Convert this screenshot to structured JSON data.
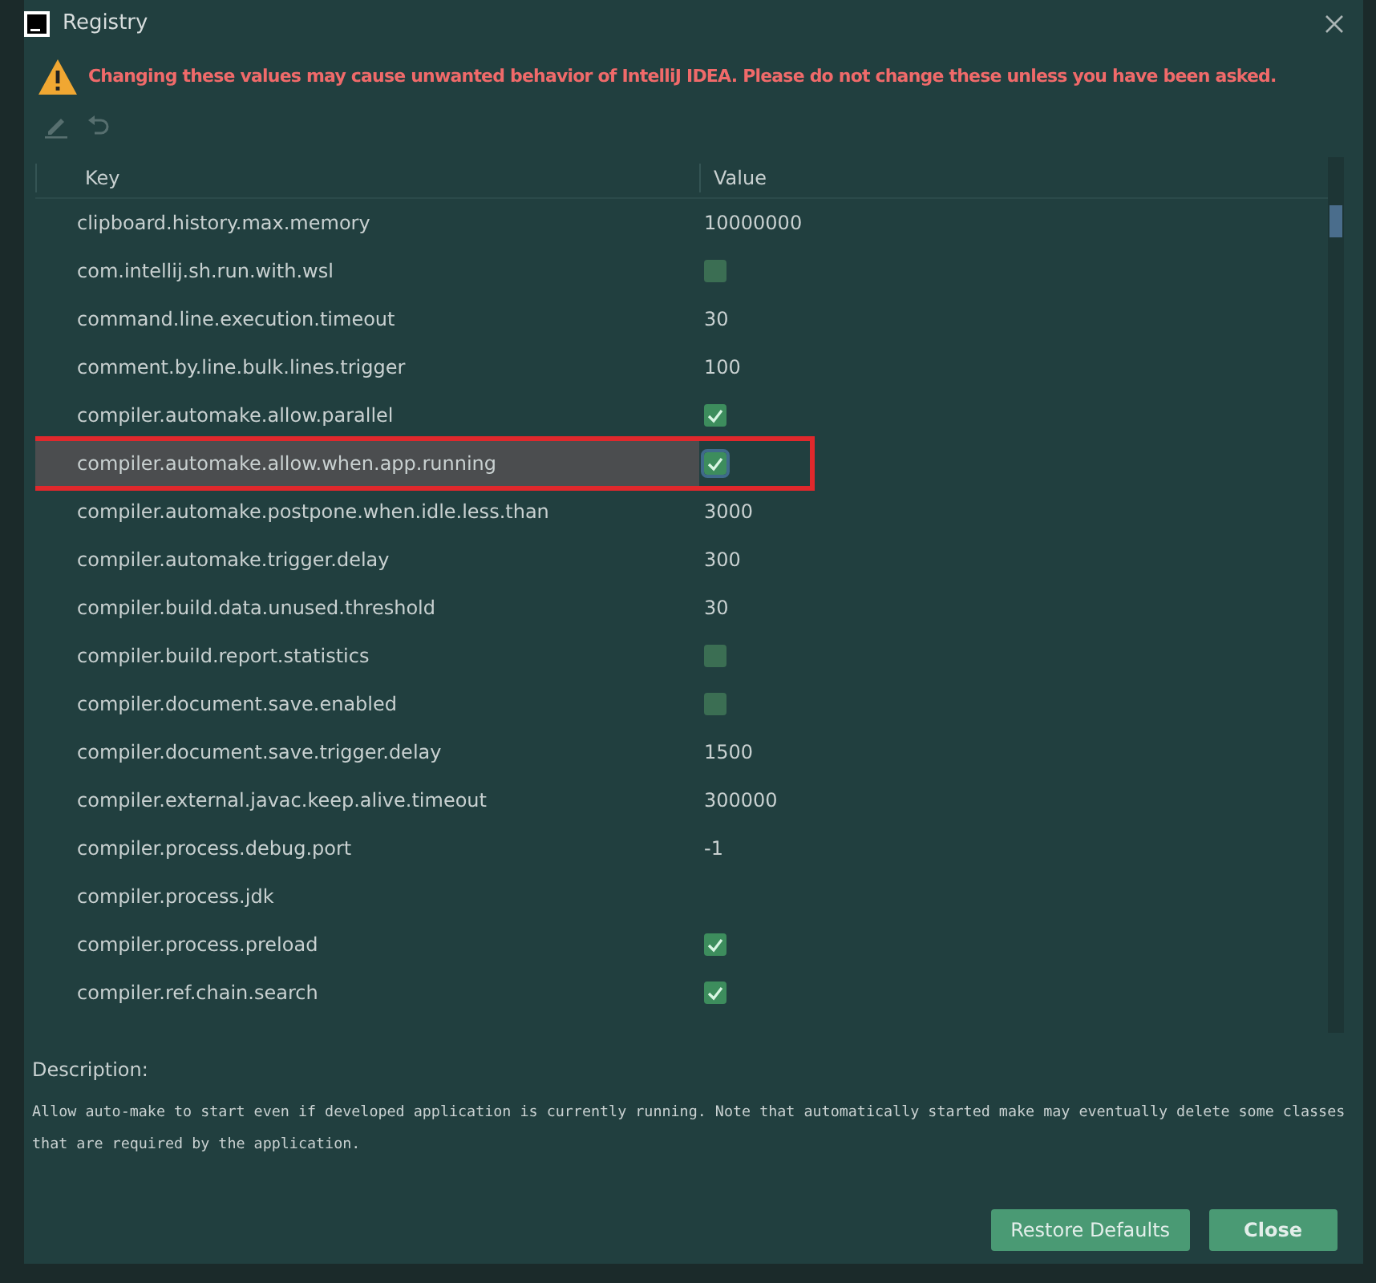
{
  "window": {
    "title": "Registry"
  },
  "warning": "Changing these values may cause unwanted behavior of IntelliJ IDEA. Please do not change these unless you have been asked.",
  "toolbar": [
    {
      "kind": "edit",
      "disabled": true
    },
    {
      "kind": "revert",
      "disabled": true
    }
  ],
  "table": {
    "columns": [
      "Key",
      "Value"
    ],
    "rows": [
      {
        "key": "clipboard.history.max.memory",
        "kind": "text",
        "value": "10000000",
        "selected": false
      },
      {
        "key": "com.intellij.sh.run.with.wsl",
        "kind": "checkbox",
        "checked": false,
        "selected": false
      },
      {
        "key": "command.line.execution.timeout",
        "kind": "text",
        "value": "30",
        "selected": false
      },
      {
        "key": "comment.by.line.bulk.lines.trigger",
        "kind": "text",
        "value": "100",
        "selected": false
      },
      {
        "key": "compiler.automake.allow.parallel",
        "kind": "checkbox",
        "checked": true,
        "selected": false
      },
      {
        "key": "compiler.automake.allow.when.app.running",
        "kind": "checkbox",
        "checked": true,
        "selected": true,
        "annotated": true
      },
      {
        "key": "compiler.automake.postpone.when.idle.less.than",
        "kind": "text",
        "value": "3000",
        "selected": false
      },
      {
        "key": "compiler.automake.trigger.delay",
        "kind": "text",
        "value": "300",
        "selected": false
      },
      {
        "key": "compiler.build.data.unused.threshold",
        "kind": "text",
        "value": "30",
        "selected": false
      },
      {
        "key": "compiler.build.report.statistics",
        "kind": "checkbox",
        "checked": false,
        "selected": false
      },
      {
        "key": "compiler.document.save.enabled",
        "kind": "checkbox",
        "checked": false,
        "selected": false
      },
      {
        "key": "compiler.document.save.trigger.delay",
        "kind": "text",
        "value": "1500",
        "selected": false
      },
      {
        "key": "compiler.external.javac.keep.alive.timeout",
        "kind": "text",
        "value": "300000",
        "selected": false
      },
      {
        "key": "compiler.process.debug.port",
        "kind": "text",
        "value": "-1",
        "selected": false
      },
      {
        "key": "compiler.process.jdk",
        "kind": "text",
        "value": "",
        "selected": false
      },
      {
        "key": "compiler.process.preload",
        "kind": "checkbox",
        "checked": true,
        "selected": false
      },
      {
        "key": "compiler.ref.chain.search",
        "kind": "checkbox",
        "checked": true,
        "selected": false
      }
    ]
  },
  "description": {
    "label": "Description:",
    "text": "Allow auto-make to start even if developed application is currently running. Note that automatically started make may eventually delete some classes that are required by the application."
  },
  "buttons": [
    {
      "label": "Restore Defaults",
      "default": false
    },
    {
      "label": "Close",
      "default": true
    }
  ]
}
